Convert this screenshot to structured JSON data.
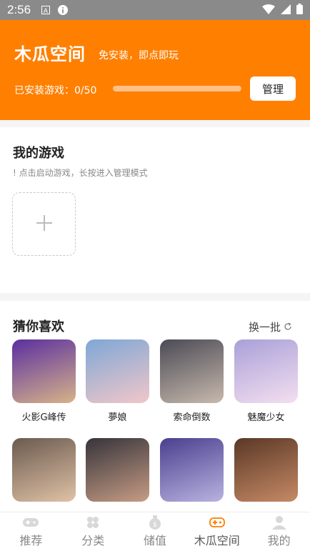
{
  "status_bar": {
    "time": "2:56",
    "icons": [
      "font-a-icon",
      "info-icon",
      "wifi-icon",
      "signal-icon",
      "battery-icon"
    ]
  },
  "header": {
    "title": "木瓜空间",
    "subtitle": "免安装，即点即玩",
    "installed_label": "已安装游戏：0/50",
    "installed_progress": 0,
    "manage_label": "管理",
    "accent": "#ff7f00"
  },
  "my_games": {
    "title": "我的游戏",
    "hint": "! 点击启动游戏，长按进入管理模式",
    "add_icon": "plus-icon"
  },
  "recommend": {
    "title": "猜你喜欢",
    "refresh_label": "换一批",
    "refresh_icon": "refresh-icon",
    "games": [
      {
        "name": "火影G峰传",
        "colors": [
          "#5a2fa0",
          "#d7b389"
        ]
      },
      {
        "name": "夢娘",
        "colors": [
          "#7ea7d6",
          "#f1c7c9"
        ]
      },
      {
        "name": "索命倒数",
        "colors": [
          "#4b4a55",
          "#c7b9ad"
        ]
      },
      {
        "name": "魅魔少女",
        "colors": [
          "#a9a0d8",
          "#f4dff0"
        ]
      },
      {
        "name": "",
        "colors": [
          "#6b5a4f",
          "#e0c2a6"
        ]
      },
      {
        "name": "",
        "colors": [
          "#35343b",
          "#c79c84"
        ]
      },
      {
        "name": "",
        "colors": [
          "#4a3f8f",
          "#b8b3e0"
        ]
      },
      {
        "name": "",
        "colors": [
          "#5a3826",
          "#c68a66"
        ]
      }
    ]
  },
  "bottom_nav": {
    "items": [
      {
        "label": "推荐",
        "icon": "gamepad-icon",
        "active": false
      },
      {
        "label": "分类",
        "icon": "category-icon",
        "active": false
      },
      {
        "label": "储值",
        "icon": "money-bag-icon",
        "active": false
      },
      {
        "label": "木瓜空间",
        "icon": "gamepad-active-icon",
        "active": true
      },
      {
        "label": "我的",
        "icon": "user-icon",
        "active": false
      }
    ]
  }
}
